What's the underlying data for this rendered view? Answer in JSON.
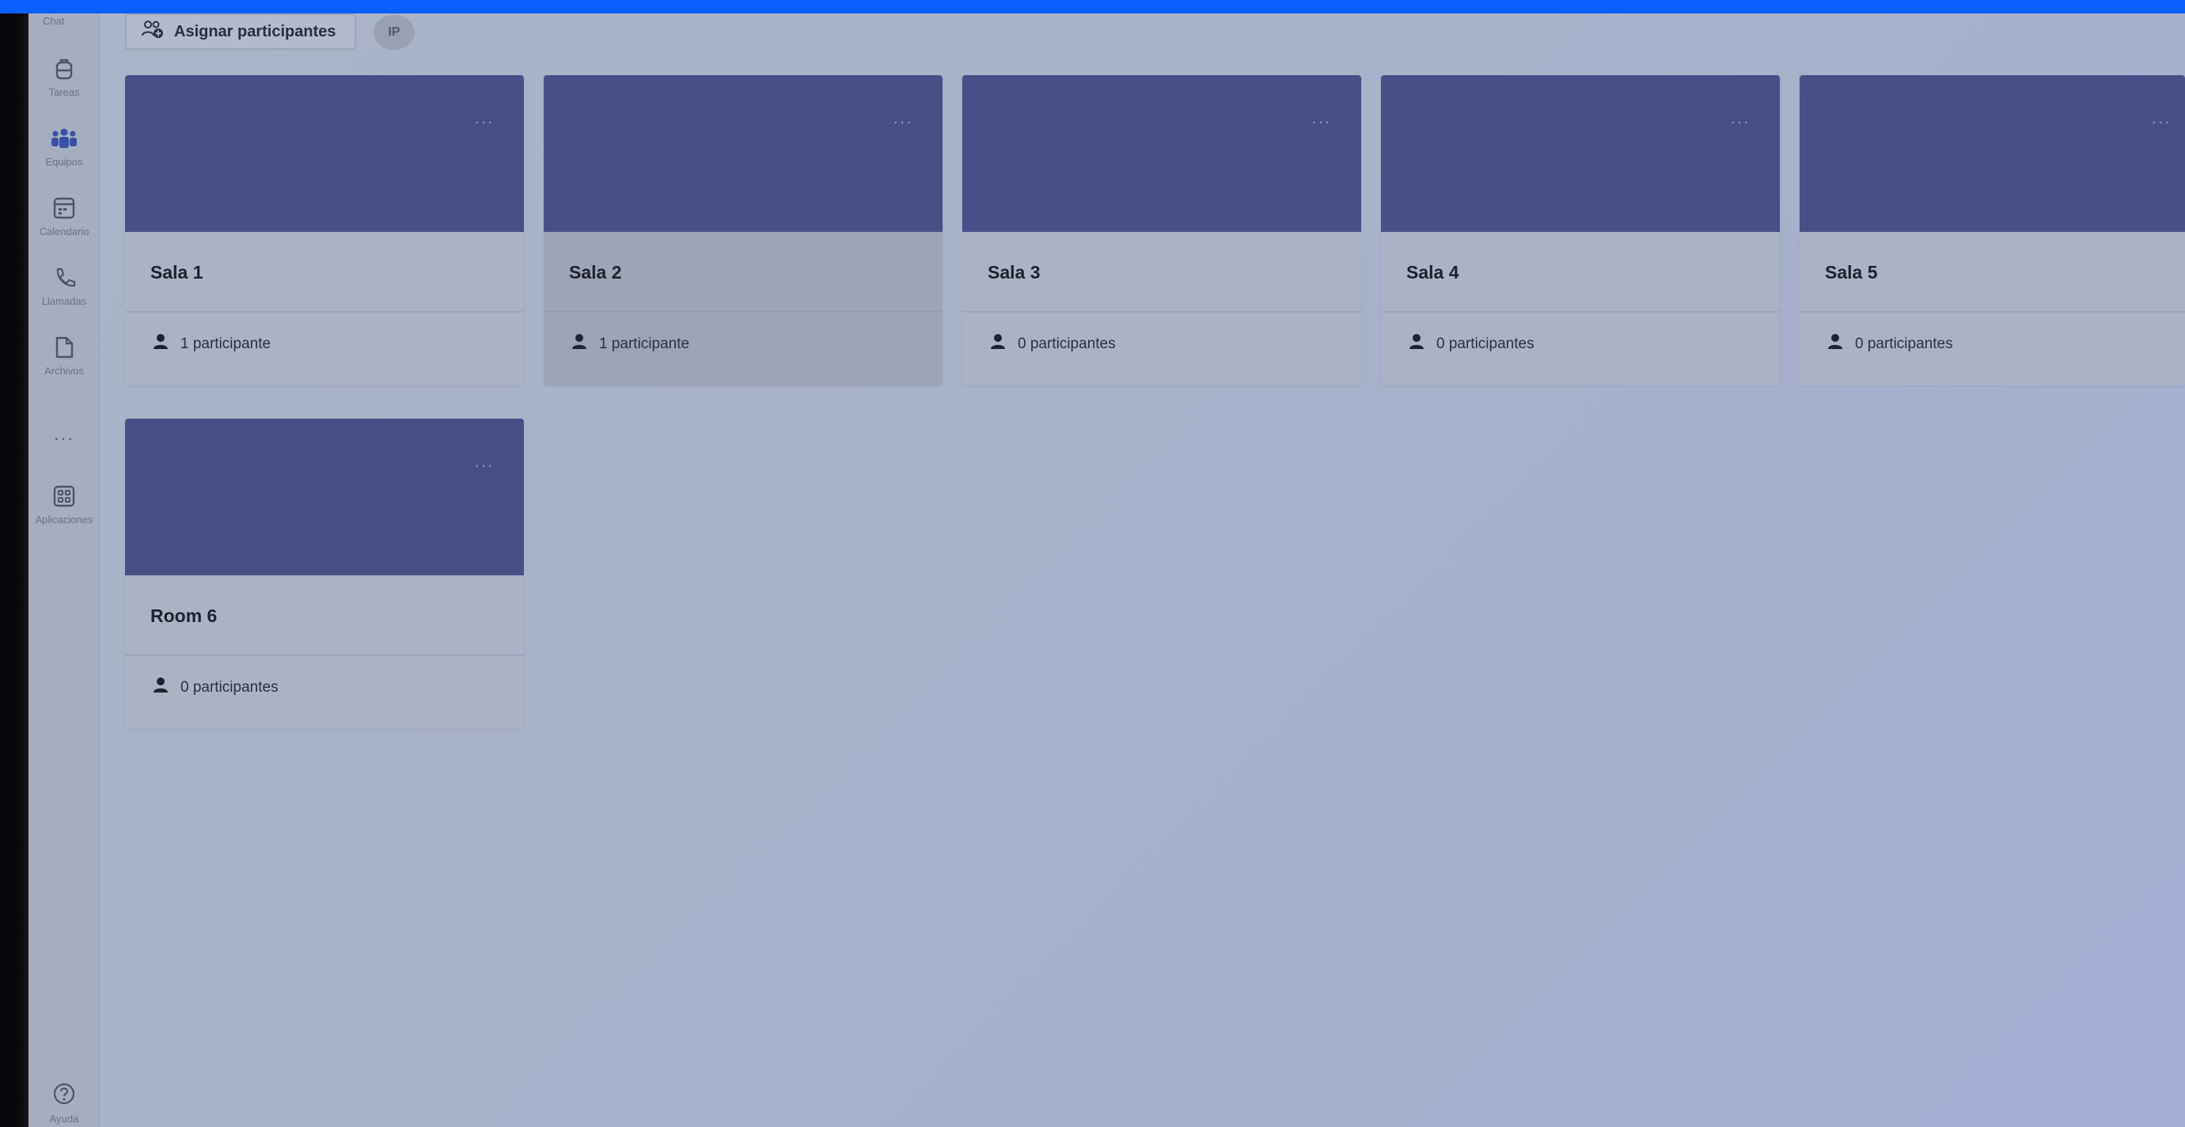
{
  "rail": {
    "top_label": "Chat",
    "items": [
      {
        "label": "Tareas",
        "icon": "backpack-icon"
      },
      {
        "label": "Equipos",
        "icon": "teams-icon"
      },
      {
        "label": "Calendario",
        "icon": "calendar-icon"
      },
      {
        "label": "Llamadas",
        "icon": "phone-icon"
      },
      {
        "label": "Archivos",
        "icon": "file-icon"
      },
      {
        "label": "Aplicaciones",
        "icon": "apps-icon"
      }
    ],
    "more": "...",
    "help_label": "Ayuda"
  },
  "toolbar": {
    "assign_label": "Asignar participantes",
    "avatar_initials": "IP"
  },
  "rooms": [
    {
      "name": "Sala 1",
      "participants": "1 participante"
    },
    {
      "name": "Sala 2",
      "participants": "1 participante"
    },
    {
      "name": "Sala 3",
      "participants": "0 participantes"
    },
    {
      "name": "Sala 4",
      "participants": "0 participantes"
    },
    {
      "name": "Sala 5",
      "participants": "0 participantes"
    },
    {
      "name": "Room 6",
      "participants": "0 participantes"
    }
  ],
  "card_more": "···",
  "colors": {
    "banner": "#4a4e87",
    "background": "#a7b1c9",
    "frame_accent": "#0a60ff"
  }
}
